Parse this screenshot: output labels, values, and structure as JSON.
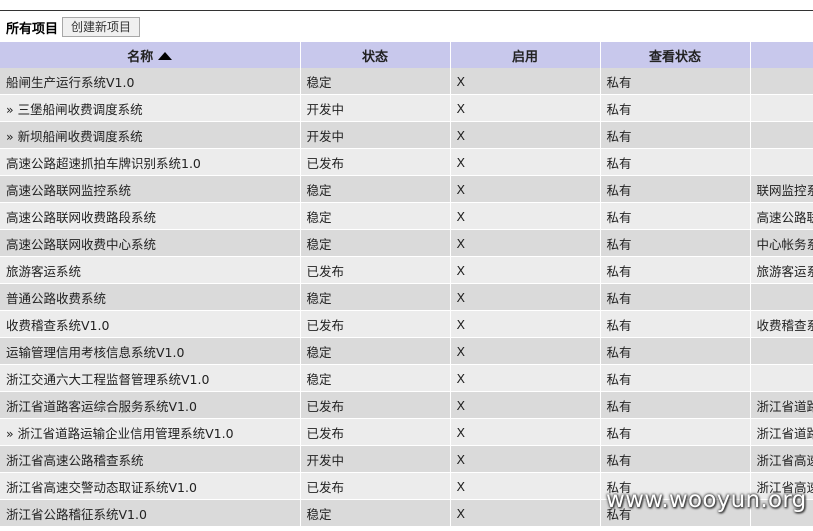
{
  "toolbar": {
    "title": "所有项目",
    "create_button": "创建新项目"
  },
  "table": {
    "headers": [
      "名称",
      "状态",
      "启用",
      "查看状态",
      ""
    ],
    "rows": [
      {
        "name": "船闸生产运行系统V1.0",
        "status": "稳定",
        "enabled": "X",
        "visibility": "私有",
        "extra": ""
      },
      {
        "name": "» 三堡船闸收费调度系统",
        "status": "开发中",
        "enabled": "X",
        "visibility": "私有",
        "extra": ""
      },
      {
        "name": "» 新坝船闸收费调度系统",
        "status": "开发中",
        "enabled": "X",
        "visibility": "私有",
        "extra": ""
      },
      {
        "name": "高速公路超速抓拍车牌识别系统1.0",
        "status": "已发布",
        "enabled": "X",
        "visibility": "私有",
        "extra": ""
      },
      {
        "name": "高速公路联网监控系统",
        "status": "稳定",
        "enabled": "X",
        "visibility": "私有",
        "extra": "联网监控系"
      },
      {
        "name": "高速公路联网收费路段系统",
        "status": "稳定",
        "enabled": "X",
        "visibility": "私有",
        "extra": "高速公路联"
      },
      {
        "name": "高速公路联网收费中心系统",
        "status": "稳定",
        "enabled": "X",
        "visibility": "私有",
        "extra": "中心帐务系"
      },
      {
        "name": "旅游客运系统",
        "status": "已发布",
        "enabled": "X",
        "visibility": "私有",
        "extra": "旅游客运系"
      },
      {
        "name": "普通公路收费系统",
        "status": "稳定",
        "enabled": "X",
        "visibility": "私有",
        "extra": ""
      },
      {
        "name": "收费稽查系统V1.0",
        "status": "已发布",
        "enabled": "X",
        "visibility": "私有",
        "extra": "收费稽查系"
      },
      {
        "name": "运输管理信用考核信息系统V1.0",
        "status": "稳定",
        "enabled": "X",
        "visibility": "私有",
        "extra": ""
      },
      {
        "name": "浙江交通六大工程监督管理系统V1.0",
        "status": "稳定",
        "enabled": "X",
        "visibility": "私有",
        "extra": ""
      },
      {
        "name": "浙江省道路客运综合服务系统V1.0",
        "status": "已发布",
        "enabled": "X",
        "visibility": "私有",
        "extra": "浙江省道路"
      },
      {
        "name": "» 浙江省道路运输企业信用管理系统V1.0",
        "status": "已发布",
        "enabled": "X",
        "visibility": "私有",
        "extra": "浙江省道路"
      },
      {
        "name": "浙江省高速公路稽查系统",
        "status": "开发中",
        "enabled": "X",
        "visibility": "私有",
        "extra": "浙江省高速"
      },
      {
        "name": "浙江省高速交警动态取证系统V1.0",
        "status": "已发布",
        "enabled": "X",
        "visibility": "私有",
        "extra": "浙江省高速"
      },
      {
        "name": "浙江省公路稽征系统V1.0",
        "status": "稳定",
        "enabled": "X",
        "visibility": "私有",
        "extra": ""
      }
    ]
  },
  "watermark": "www.wooyun.org",
  "icons": {
    "sort": "sort-ascending-icon"
  },
  "colors": {
    "header_bg": "#c8c8ec",
    "row_odd": "#dadada",
    "row_even": "#ececec"
  }
}
